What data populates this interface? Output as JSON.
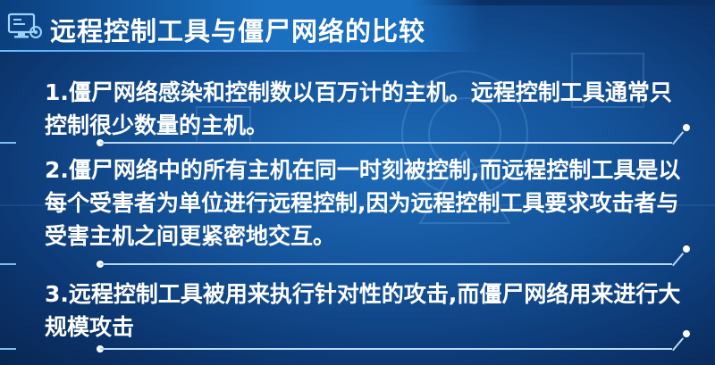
{
  "title": "远程控制工具与僵尸网络的比较",
  "points": [
    "1.僵尸网络感染和控制数以百万计的主机。远程控制工具通常只控制很少数量的主机。",
    "2.僵尸网络中的所有主机在同一时刻被控制,而远程控制工具是以每个受害者为单位进行远程控制,因为远程控制工具要求攻击者与受害主机之间更紧密地交互。",
    "3.远程控制工具被用来执行针对性的攻击,而僵尸网络用来进行大规模攻击"
  ],
  "colors": {
    "background": "#14539a",
    "title_bar": "#1a6fc0",
    "text": "#ffffff",
    "divider": "#b9d9f5"
  },
  "icons": [
    "monitor-settings-icon"
  ]
}
